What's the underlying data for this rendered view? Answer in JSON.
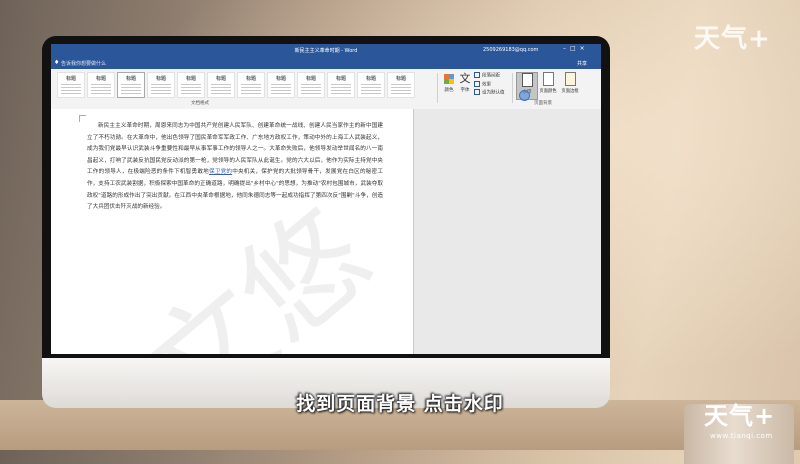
{
  "word": {
    "doc_title": "新民主主义革命时期 - Word",
    "account": "2509269183@qq.com",
    "tell_me": "告诉我你想要做什么",
    "share": "共享",
    "styles": [
      {
        "label": "标题"
      },
      {
        "label": "标题"
      },
      {
        "label": "标题"
      },
      {
        "label": "标题"
      },
      {
        "label": "标题"
      },
      {
        "label": "标题"
      },
      {
        "label": "标题"
      },
      {
        "label": "标题"
      },
      {
        "label": "标题"
      },
      {
        "label": "标题"
      },
      {
        "label": "标题"
      },
      {
        "label": "标题"
      }
    ],
    "styles_group": "文档格式",
    "colors_label": "颜色",
    "fonts_label": "字体",
    "fonts_glyph": "文",
    "paragraph_spacing": "段落间距",
    "effects": "效果",
    "set_default": "设为默认值",
    "page_background": {
      "group_label": "页面背景",
      "watermark": "水印",
      "page_color": "页面颜色",
      "page_borders": "页面边框"
    },
    "body_text": "新民主主义革命时期，周恩来同志为中国共产党创建人民军队、创建革命统一战线、创建人民当家作主的新中国建立了不朽功勋。在大革命中，他出色领导了国民革命军军政工作、广东地方政权工作，策动中外的上海工人武装起义，成为我们党最早认识武装斗争重要性和最早从事军事工作的领导人之一。大革命失败后，他领导发动举世闻名的八一南昌起义，打响了武装反抗国民党反动派的第一枪，党领导的人民军队从此诞生。党的六大以后，他作为实际主持党中央工作的领导人，在极端险恶的条件下机智勇敢地保卫党的中央机关，保护党的大批领导骨干，发展党在白区的秘密工作，支持工农武装割据，积极探索中国革命的正确道路，明确提出\"乡村中心\"的思想，为推动\"农村包围城市，武装夺取政权\"道路的形成作出了突出贡献。在江西中央革命根据地，他同朱德同志等一起成功指挥了第四次反\"围剿\"斗争，创造了大兵团伏击歼灭战的新经验。",
    "link_text": "保卫党的"
  },
  "overlay": {
    "subtitle": "找到页面背景 点击水印",
    "logo_top": "天气+",
    "logo_bottom": "天气+",
    "logo_url": "www.tianqi.com"
  },
  "colors": {
    "word_blue": "#2b579a",
    "link": "#3a5fae"
  },
  "icons": [
    "lightbulb-icon",
    "colors-icon",
    "fonts-icon",
    "watermark-icon",
    "page-color-icon",
    "page-borders-icon"
  ]
}
